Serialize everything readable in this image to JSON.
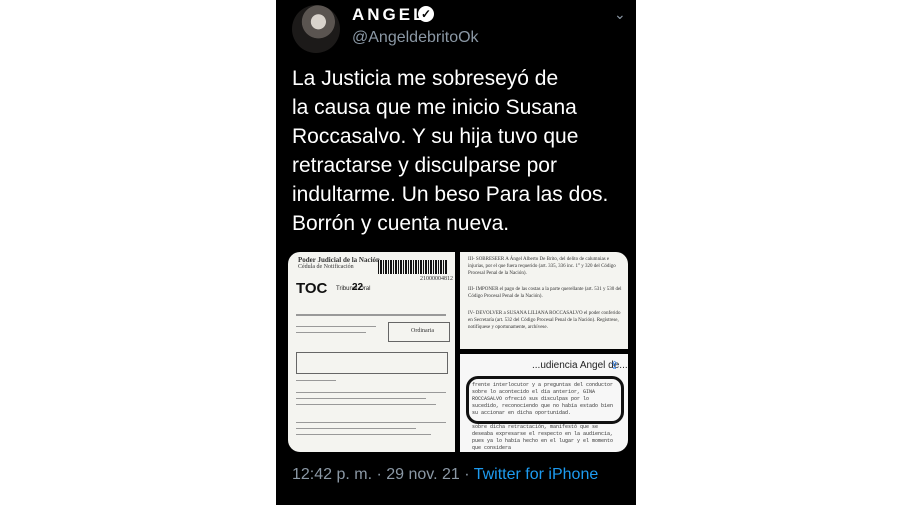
{
  "tweet": {
    "display_name": "ANGEL",
    "handle": "@AngeldebritoOk",
    "text": "La Justicia me sobreseyó de\nla causa que me inicio Susana\nRoccasalvo. Y su hija tuvo que\nretractarse y disculparse por\nindultarme. Un beso Para las dos.\nBorrón y cuenta nueva.",
    "time": "12:42 p. m. · 29 nov. 21 ·",
    "source": "Twitter for iPhone"
  },
  "media": {
    "doc1": {
      "header": "Poder Judicial de la Nación",
      "sub": "Cédula de Notificación",
      "barcode_num": "21000004812",
      "toc": "TOC",
      "tribunal_label": "Tribunal Oral",
      "tribunal_num": "22",
      "stamp": "Ordinaria"
    },
    "doc2": {
      "para1": "III- SOBRESEER A Ángel Alberto De Brito, del delito de calumnias e injurias, por el que fuera requerido (art. 335, 336 inc. 1° y 320 del Código Procesal Penal de la Nación).",
      "para2": "III- IMPONER el pago de las costas a la parte querellante (art. 531 y 530 del Código Procesal Penal de la Nación).",
      "para3": "IV- DEVOLVER a SUSANA LILIANA ROCCASALVO el poder conferido en Secretaría (art. 532 del Código Procesal Penal de la Nación). Regístrese, notifíquese y oportunamente, archívese."
    },
    "doc3": {
      "title": "...udiencia Angel de...",
      "quote": "frente interlocutor y a preguntas del conductor sobre lo acontecido el día anterior, GINA ROCCASALVO ofreció sus disculpas por lo sucedido, reconociendo que no había estado bien su accionar en dicha oportunidad.",
      "rest": "sobre dicha retractación, manifestó que se deseaba expresarse el respecto en la audiencia, pues ya lo había hecho en el lugar y el momento que considera"
    }
  }
}
